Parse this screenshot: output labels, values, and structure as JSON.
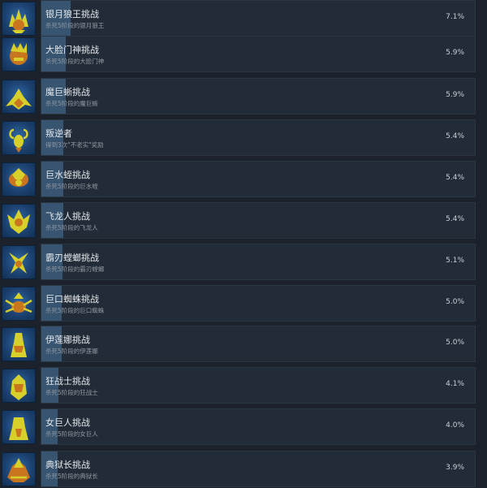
{
  "achievements": [
    {
      "title": "银月狼王挑战",
      "desc": "杀死5阶段的银月狼王",
      "percent_label": "7.1%",
      "percent": 7.1,
      "icon": "wolf-king-icon"
    },
    {
      "title": "大脸门神挑战",
      "desc": "杀死5阶段的大脸门神",
      "percent_label": "5.9%",
      "percent": 5.9,
      "icon": "big-face-gatekeeper-icon"
    },
    {
      "title": "魔巨蜥挑战",
      "desc": "杀死5阶段的魔巨蜥",
      "percent_label": "5.9%",
      "percent": 5.9,
      "icon": "giant-lizard-icon"
    },
    {
      "title": "叛逆者",
      "desc": "得到3次\"不老实\"奖励",
      "percent_label": "5.4%",
      "percent": 5.4,
      "icon": "rebel-icon"
    },
    {
      "title": "巨水蛭挑战",
      "desc": "杀死5阶段的巨水蛭",
      "percent_label": "5.4%",
      "percent": 5.4,
      "icon": "water-leech-icon"
    },
    {
      "title": "飞龙人挑战",
      "desc": "杀死5阶段的飞龙人",
      "percent_label": "5.4%",
      "percent": 5.4,
      "icon": "dragon-man-icon"
    },
    {
      "title": "霸刃螳螂挑战",
      "desc": "杀死5阶段的霸刃螳螂",
      "percent_label": "5.1%",
      "percent": 5.1,
      "icon": "mantis-icon"
    },
    {
      "title": "巨口蜘蛛挑战",
      "desc": "杀死5阶段的巨口蜘蛛",
      "percent_label": "5.0%",
      "percent": 5.0,
      "icon": "spider-icon"
    },
    {
      "title": "伊莲娜挑战",
      "desc": "杀死5阶段的伊莲娜",
      "percent_label": "5.0%",
      "percent": 5.0,
      "icon": "elena-icon"
    },
    {
      "title": "狂战士挑战",
      "desc": "杀死5阶段的狂战士",
      "percent_label": "4.1%",
      "percent": 4.1,
      "icon": "berserker-icon"
    },
    {
      "title": "女巨人挑战",
      "desc": "杀死5阶段的女巨人",
      "percent_label": "4.0%",
      "percent": 4.0,
      "icon": "giantess-icon"
    },
    {
      "title": "典狱长挑战",
      "desc": "杀死5阶段的典狱长",
      "percent_label": "3.9%",
      "percent": 3.9,
      "icon": "warden-icon"
    }
  ],
  "colors": {
    "icon_yellow": "#d8d02a",
    "icon_orange": "#c9761e",
    "bar_fill": "#3f6284"
  }
}
